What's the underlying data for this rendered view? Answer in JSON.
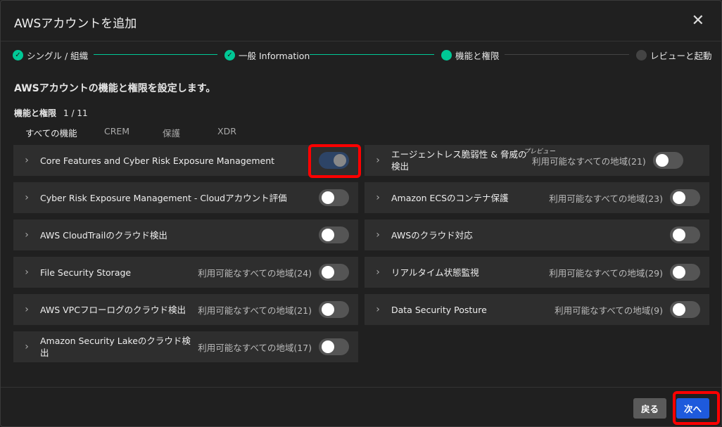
{
  "title": "AWSアカウントを追加",
  "steps": [
    {
      "label": "シングル / 組織",
      "state": "done"
    },
    {
      "label": "一般 Information",
      "state": "done"
    },
    {
      "label": "機能と権限",
      "state": "current"
    },
    {
      "label": "レビューと起動",
      "state": "pending"
    }
  ],
  "heading": "AWSアカウントの機能と権限を設定します。",
  "section": {
    "label": "機能と権限",
    "count": "1 / 11"
  },
  "tabs": [
    "すべての機能",
    "CREM",
    "保護",
    "XDR"
  ],
  "left": [
    {
      "label": "Core Features and Cyber Risk Exposure Management",
      "region": "",
      "on": true
    },
    {
      "label": "Cyber Risk Exposure Management - Cloudアカウント評価",
      "region": "",
      "on": false
    },
    {
      "label": "AWS CloudTrailのクラウド検出",
      "region": "",
      "on": false
    },
    {
      "label": "File Security Storage",
      "region": "利用可能なすべての地域(24)",
      "on": false
    },
    {
      "label": "AWS VPCフローログのクラウド検出",
      "region": "利用可能なすべての地域(21)",
      "on": false
    },
    {
      "label": "Amazon Security Lakeのクラウド検出",
      "region": "利用可能なすべての地域(17)",
      "on": false
    }
  ],
  "right": [
    {
      "label": "エージェントレス脆弱性 & 脅威の検出",
      "badge": "プレビュー",
      "region": "利用可能なすべての地域(21)",
      "on": false
    },
    {
      "label": "Amazon ECSのコンテナ保護",
      "region": "利用可能なすべての地域(23)",
      "on": false
    },
    {
      "label": "AWSのクラウド対応",
      "region": "",
      "on": false
    },
    {
      "label": "リアルタイム状態監視",
      "region": "利用可能なすべての地域(29)",
      "on": false
    },
    {
      "label": "Data Security Posture",
      "region": "利用可能なすべての地域(9)",
      "on": false
    }
  ],
  "footer": {
    "back": "戻る",
    "next": "次へ"
  },
  "colors": {
    "accent": "#00c896",
    "primary": "#1e5adc",
    "highlight": "#ff0000"
  }
}
